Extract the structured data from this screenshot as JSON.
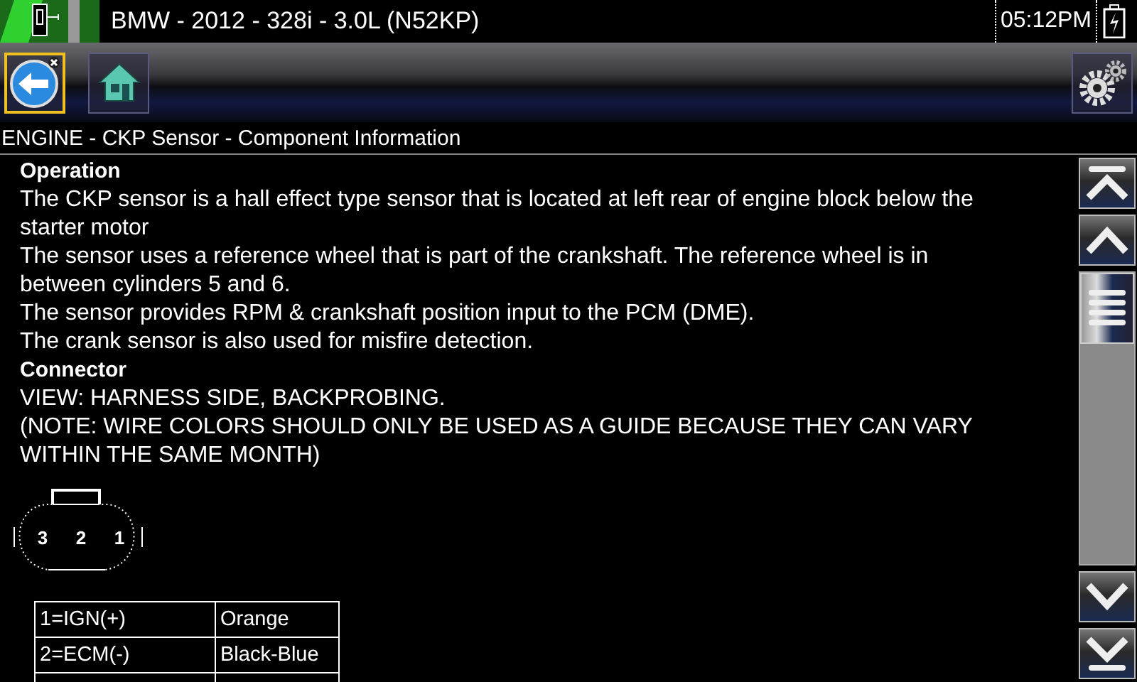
{
  "status_bar": {
    "vehicle": "BMW - 2012 - 328i - 3.0L (N52KP)",
    "time": "05:12PM"
  },
  "header": {
    "title": "ENGINE - CKP Sensor - Component Information"
  },
  "sections": [
    {
      "heading": "Operation",
      "paragraphs": [
        "The CKP sensor is a hall effect type sensor that is located at left rear of engine block below the starter motor",
        "The sensor uses a reference wheel that is part of the crankshaft. The reference wheel is in between cylinders 5 and 6.",
        "The sensor provides RPM & crankshaft position input to the PCM (DME).",
        "The crank sensor is also used for misfire detection."
      ]
    },
    {
      "heading": "Connector",
      "paragraphs": [
        "VIEW: HARNESS SIDE, BACKPROBING.",
        "(NOTE: WIRE COLORS SHOULD ONLY BE USED AS A GUIDE BECAUSE THEY CAN VARY WITHIN THE SAME MONTH)"
      ]
    }
  ],
  "connector": {
    "pins": [
      "3",
      "2",
      "1"
    ]
  },
  "pin_table": {
    "rows": [
      {
        "pin": "1=IGN(+)",
        "wire": "Orange"
      },
      {
        "pin": "2=ECM(-)",
        "wire": "Black-Blue"
      },
      {}
    ]
  }
}
